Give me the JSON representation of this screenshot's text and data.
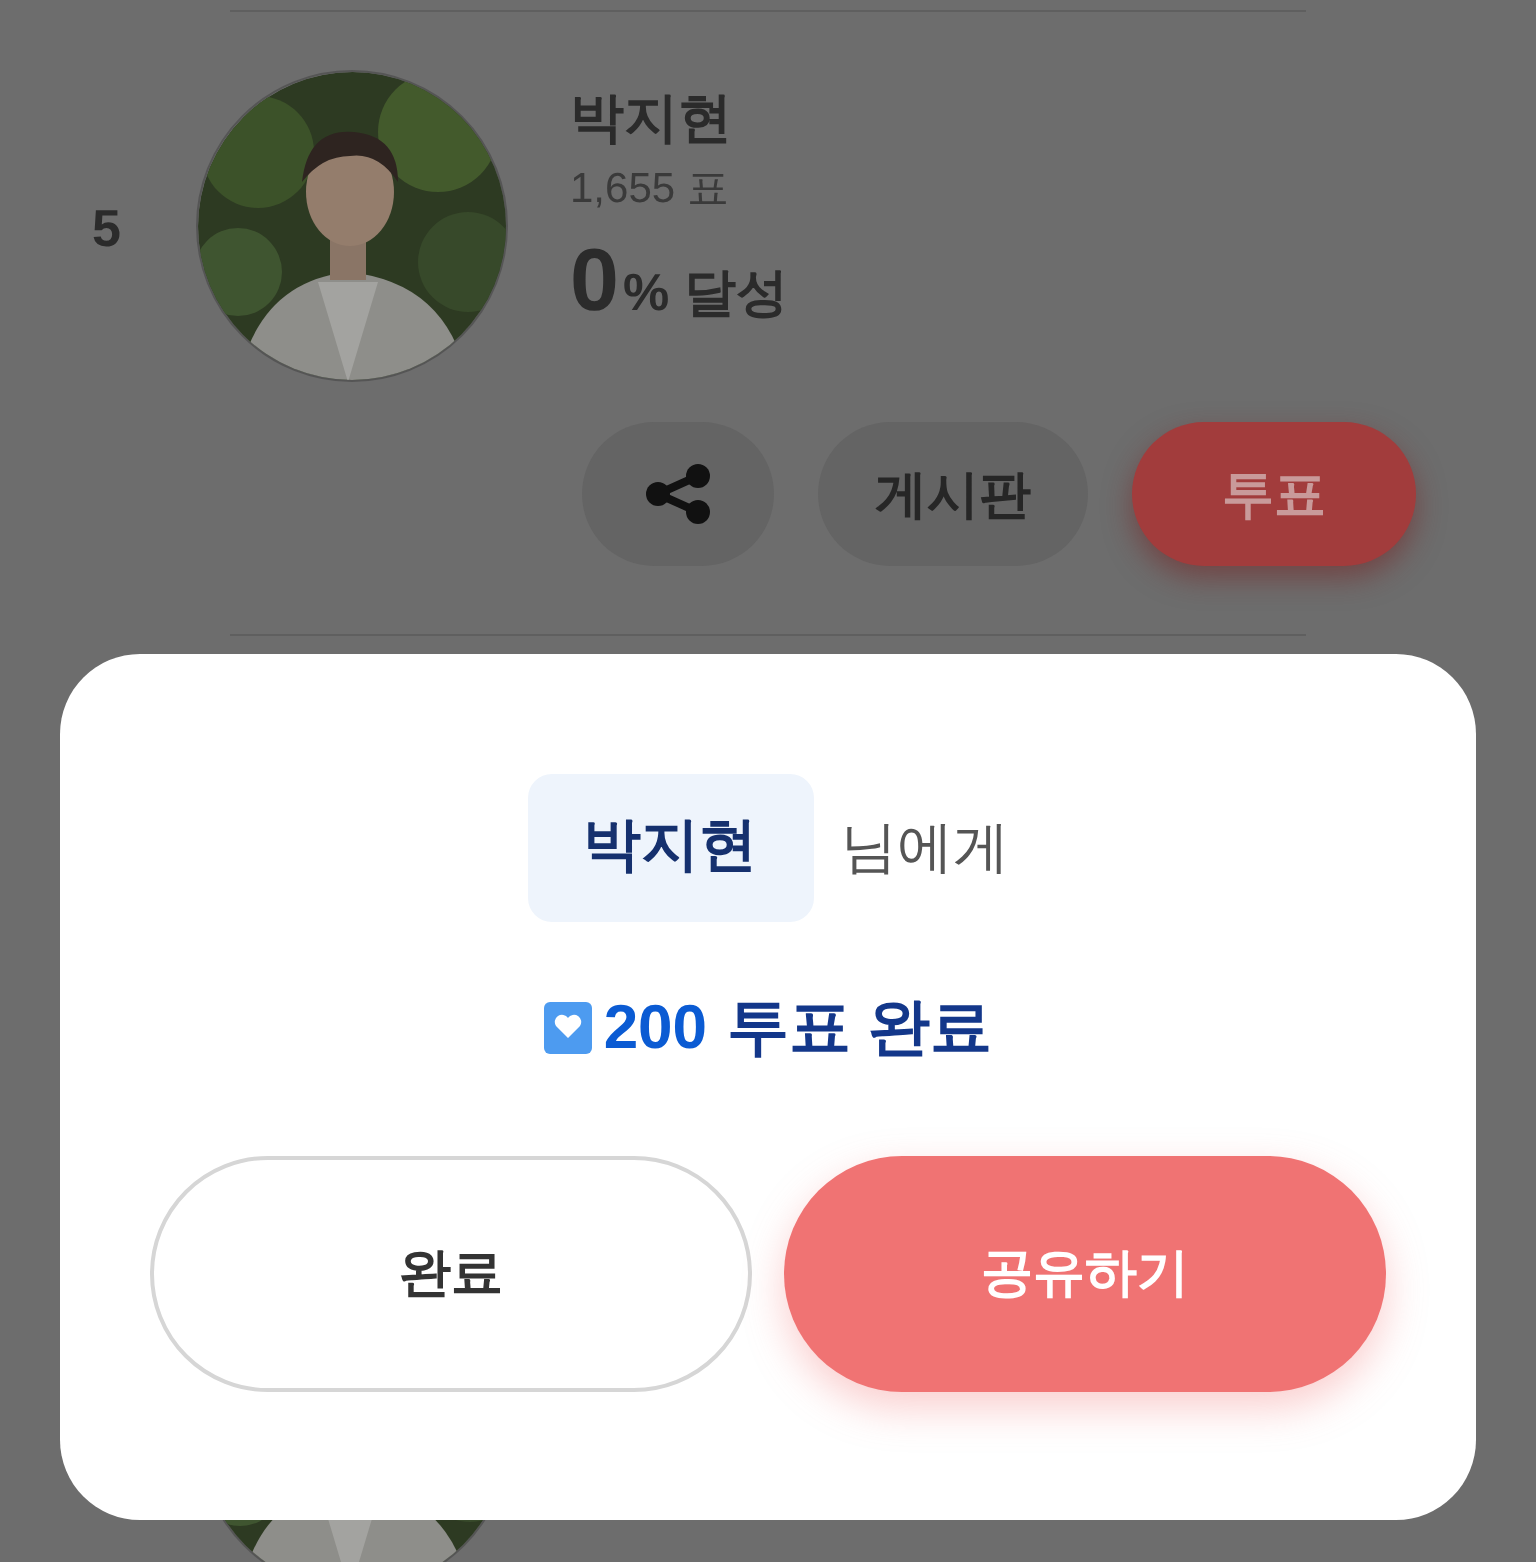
{
  "candidates": [
    {
      "rank": "5",
      "name": "박지현",
      "votes": "1,655 표",
      "percent": "0",
      "percent_suffix": "% 달성",
      "actions": [
        {
          "kind": "share"
        },
        {
          "kind": "board",
          "label": "게시판"
        },
        {
          "kind": "vote",
          "label": "투표"
        }
      ]
    }
  ],
  "dialog": {
    "recipient": "박지현",
    "recipient_suffix": "님에게",
    "vote_count": "200",
    "vote_text": "투표 완료",
    "buttons": [
      {
        "kind": "secondary",
        "label": "완료"
      },
      {
        "kind": "primary",
        "label": "공유하기"
      }
    ]
  }
}
